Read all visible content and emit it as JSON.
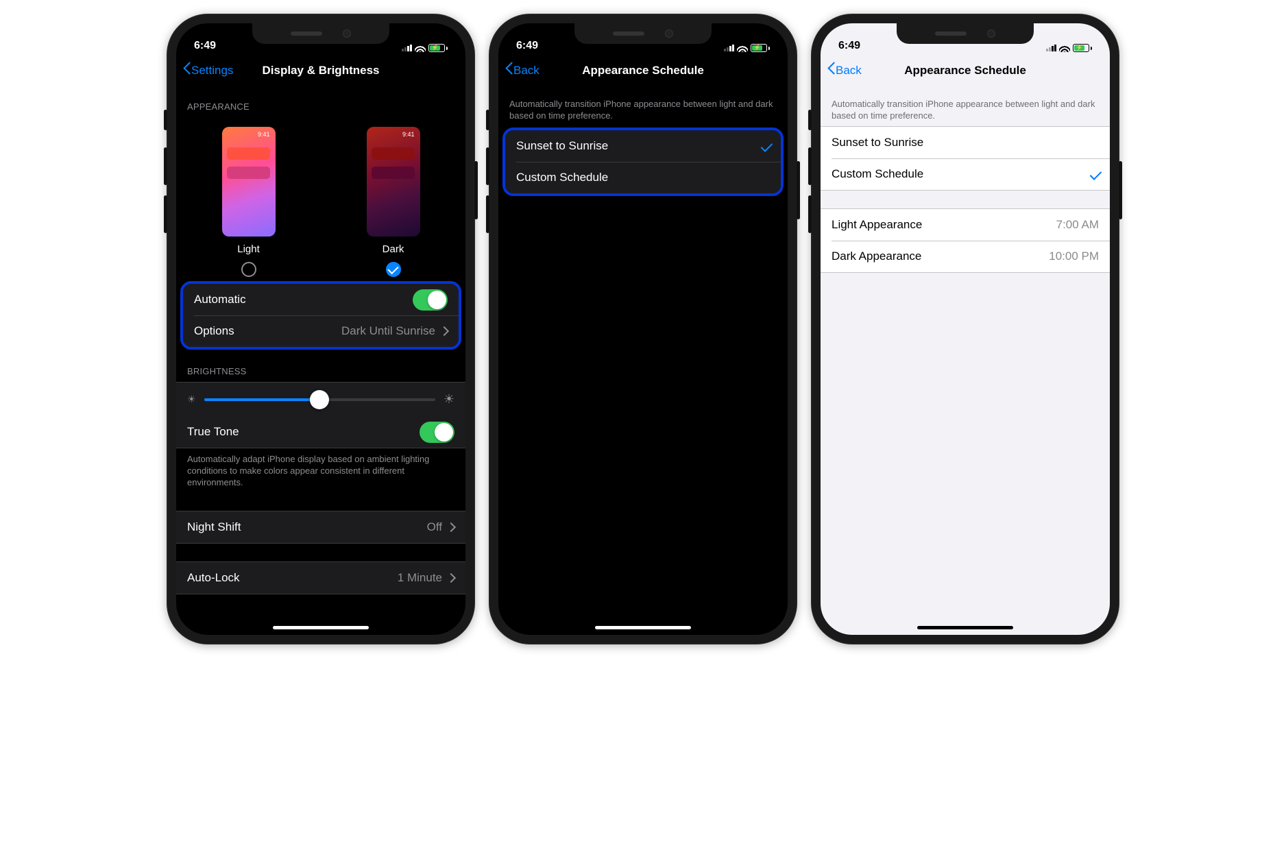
{
  "status": {
    "time": "6:49"
  },
  "screen1": {
    "back_label": "Settings",
    "title": "Display & Brightness",
    "appearance_header": "APPEARANCE",
    "thumb_time": "9:41",
    "light_label": "Light",
    "dark_label": "Dark",
    "automatic_label": "Automatic",
    "options_label": "Options",
    "options_value": "Dark Until Sunrise",
    "brightness_header": "BRIGHTNESS",
    "brightness_percent": 50,
    "true_tone_label": "True Tone",
    "true_tone_footer": "Automatically adapt iPhone display based on ambient lighting conditions to make colors appear consistent in different environments.",
    "night_shift_label": "Night Shift",
    "night_shift_value": "Off",
    "auto_lock_label": "Auto-Lock",
    "auto_lock_value": "1 Minute"
  },
  "screen2": {
    "back_label": "Back",
    "title": "Appearance Schedule",
    "desc": "Automatically transition iPhone appearance between light and dark based on time preference.",
    "opt1": "Sunset to Sunrise",
    "opt2": "Custom Schedule",
    "selected": "opt1"
  },
  "screen3": {
    "back_label": "Back",
    "title": "Appearance Schedule",
    "desc": "Automatically transition iPhone appearance between light and dark based on time preference.",
    "opt1": "Sunset to Sunrise",
    "opt2": "Custom Schedule",
    "selected": "opt2",
    "light_row_label": "Light Appearance",
    "light_row_value": "7:00 AM",
    "dark_row_label": "Dark Appearance",
    "dark_row_value": "10:00 PM"
  }
}
